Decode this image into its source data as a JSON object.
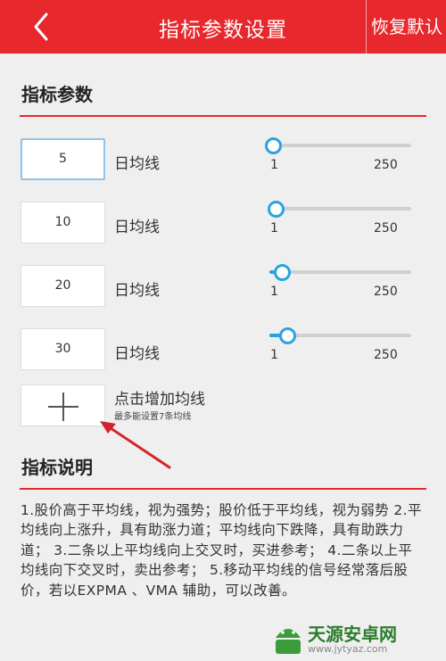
{
  "header": {
    "title": "指标参数设置",
    "reset_label": "恢复默认"
  },
  "params_section": {
    "title": "指标参数",
    "items": [
      {
        "value": "5",
        "label": "日均线",
        "slider_min": "1",
        "slider_max": "250",
        "slider_fraction": 0.0
      },
      {
        "value": "10",
        "label": "日均线",
        "slider_min": "1",
        "slider_max": "250",
        "slider_fraction": 0.02
      },
      {
        "value": "20",
        "label": "日均线",
        "slider_min": "1",
        "slider_max": "250",
        "slider_fraction": 0.06
      },
      {
        "value": "30",
        "label": "日均线",
        "slider_min": "1",
        "slider_max": "250",
        "slider_fraction": 0.1
      }
    ],
    "add_label": "点击增加均线",
    "add_hint": "最多能设置7条均线"
  },
  "desc_section": {
    "title": "指标说明",
    "text": "1.股价高于平均线，视为强势；股价低于平均线，视为弱势 2.平均线向上涨升，具有助涨力道；平均线向下跌降，具有助跌力道； 3.二条以上平均线向上交叉时，买进参考； 4.二条以上平均线向下交叉时，卖出参考； 5.移动平均线的信号经常落后股价，若以EXPMA 、VMA 辅助，可以改善。"
  },
  "watermark": {
    "name": "天源安卓网",
    "url": "www.jytyaz.com"
  },
  "colors": {
    "header_red": "#e7282c",
    "slider_blue": "#2aa3df",
    "arrow_red": "#d4232a",
    "logo_green": "#2b7c2b"
  }
}
